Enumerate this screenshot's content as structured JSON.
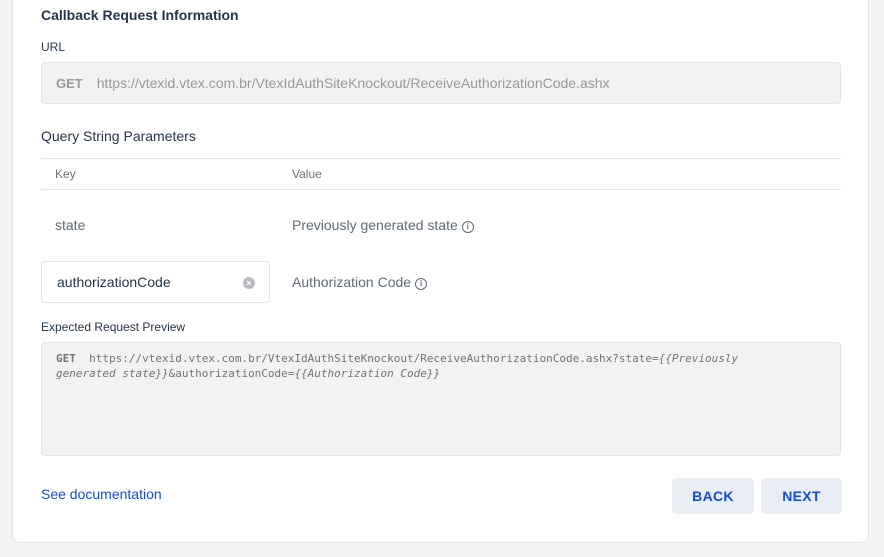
{
  "section_title": "Callback Request Information",
  "url_label": "URL",
  "url": {
    "method": "GET",
    "value": "https://vtexid.vtex.com.br/VtexIdAuthSiteKnockout/ReceiveAuthorizationCode.ashx"
  },
  "query_params": {
    "title": "Query String Parameters",
    "headers": {
      "key": "Key",
      "value": "Value"
    },
    "rows": [
      {
        "key": "state",
        "value": "Previously generated state"
      },
      {
        "key": "authorizationCode",
        "value": "Authorization Code"
      }
    ]
  },
  "preview": {
    "label": "Expected Request Preview",
    "method": "GET",
    "url": "https://vtexid.vtex.com.br/VtexIdAuthSiteKnockout/ReceiveAuthorizationCode.ashx?state=",
    "state_placeholder_line1": "{{Previously",
    "state_placeholder_line2": "generated state}}",
    "auth_param": "&authorizationCode=",
    "auth_placeholder": "{{Authorization Code}}"
  },
  "footer": {
    "doc_link": "See documentation",
    "back_label": "BACK",
    "next_label": "NEXT"
  },
  "colors": {
    "accent": "#134cd8",
    "button_bg": "#e9eef5",
    "field_bg": "#f1f2f4"
  }
}
